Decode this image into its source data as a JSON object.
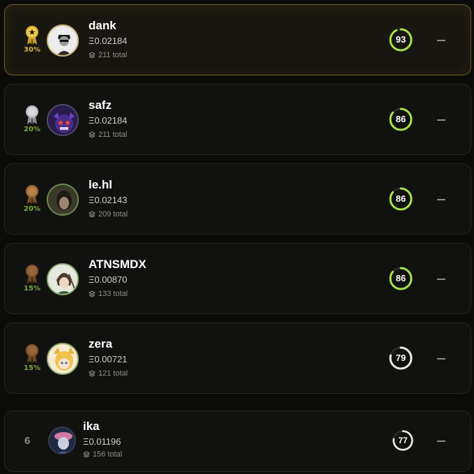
{
  "rows": [
    {
      "name": "dank",
      "amount": "Ξ0.02184",
      "total": "211 total",
      "pct": "30%",
      "score": "93",
      "score_pct": 0.93,
      "medal": "gold",
      "change": "—"
    },
    {
      "name": "safz",
      "amount": "Ξ0.02184",
      "total": "211 total",
      "pct": "20%",
      "score": "86",
      "score_pct": 0.86,
      "medal": "silver",
      "change": "—"
    },
    {
      "name": "le.hl",
      "amount": "Ξ0.02143",
      "total": "209 total",
      "pct": "20%",
      "score": "86",
      "score_pct": 0.86,
      "medal": "bronze",
      "change": "—"
    },
    {
      "name": "ATNSMDX",
      "amount": "Ξ0.00870",
      "total": "133 total",
      "pct": "15%",
      "score": "86",
      "score_pct": 0.86,
      "medal": "bronze",
      "change": "—"
    },
    {
      "name": "zera",
      "amount": "Ξ0.00721",
      "total": "121 total",
      "pct": "15%",
      "score": "79",
      "score_pct": 0.79,
      "medal": "bronze",
      "change": "—"
    },
    {
      "name": "ika",
      "amount": "Ξ0.01196",
      "total": "156 total",
      "rank": "6",
      "score": "77",
      "score_pct": 0.77,
      "medal": "none",
      "change": "—"
    }
  ],
  "colors": {
    "gold": "#e2b93b",
    "silver": "#b9bcc0",
    "bronze": "#9b6a36",
    "green_ring": "#a6e34a",
    "white_ring": "#e9e9e6",
    "pct_gold": "#d4b44a",
    "pct_green": "#7ea93d"
  }
}
